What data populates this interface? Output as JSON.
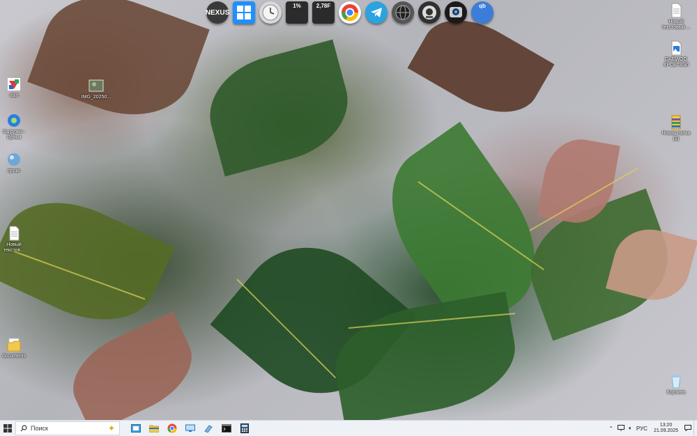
{
  "dock": {
    "items": [
      {
        "name": "nexus-icon",
        "label": "NEXUS",
        "color": "#3a3a3a"
      },
      {
        "name": "windows-icon",
        "label": "",
        "color": "#1e90ff"
      },
      {
        "name": "clock-icon",
        "label": "",
        "color": "#d9d9d9"
      },
      {
        "name": "cpu-meter-icon",
        "label": "1%",
        "color": "#2b2b2b"
      },
      {
        "name": "disk-meter-icon",
        "label": "2,78F",
        "color": "#2b2b2b"
      },
      {
        "name": "chrome-icon",
        "label": "",
        "color": "#ffffff"
      },
      {
        "name": "telegram-icon",
        "label": "",
        "color": "#2aa3df"
      },
      {
        "name": "globe-icon",
        "label": "",
        "color": "#555555"
      },
      {
        "name": "camera-icon",
        "label": "",
        "color": "#303030"
      },
      {
        "name": "webcam-icon",
        "label": "",
        "color": "#1a1a1a"
      },
      {
        "name": "qbittorrent-icon",
        "label": "qb",
        "color": "#3c7dd9"
      }
    ]
  },
  "desktop_icons": {
    "vlan": "vlan",
    "img": "IMG_20250...",
    "yandex": "Загрузки - Ярлык",
    "proxy": "прокс",
    "newtext_left": "Новый текстов...",
    "documents": "documents",
    "newtext_right": "Новый текстовый ...",
    "daewoo": "DAEWOO ХРСЕТ8ЭЛ",
    "newfolder": "Новая папка (2)",
    "recycle": "Корзина"
  },
  "taskbar": {
    "search_placeholder": "Поиск",
    "lang": "РУС",
    "time": "13:20",
    "date": "21.09.2025"
  }
}
